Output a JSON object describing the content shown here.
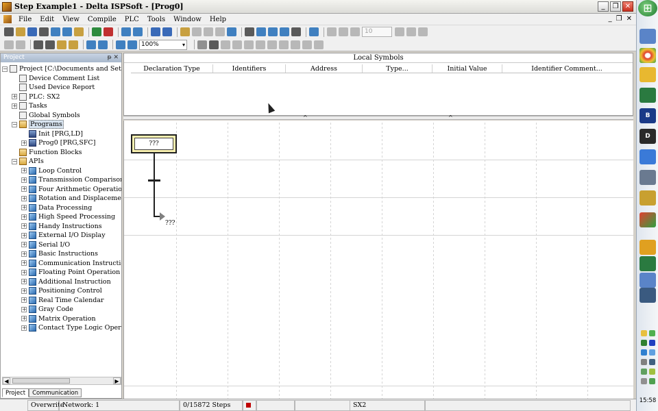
{
  "window": {
    "title": "Step Example1 - Delta ISPSoft - [Prog0]",
    "buttons": [
      "_",
      "❐",
      "✕"
    ]
  },
  "menu": {
    "items": [
      "File",
      "Edit",
      "View",
      "Compile",
      "PLC",
      "Tools",
      "Window",
      "Help"
    ],
    "mdi_buttons": [
      "_",
      "❐",
      "✕"
    ]
  },
  "toolbar": {
    "zoom": "100%",
    "spin_value": "10"
  },
  "project_panel": {
    "title": "Project",
    "controls": "ᵽ ✕",
    "tree": [
      {
        "label": "Project [C:\\Documents and Settings\\c",
        "level": 0,
        "expander": "−",
        "icon": "doc"
      },
      {
        "label": "Device Comment List",
        "level": 1,
        "expander": "",
        "icon": "doc"
      },
      {
        "label": "Used Device Report",
        "level": 1,
        "expander": "",
        "icon": "doc"
      },
      {
        "label": "PLC: SX2",
        "level": 1,
        "expander": "+",
        "icon": "doc"
      },
      {
        "label": "Tasks",
        "level": 1,
        "expander": "+",
        "icon": "doc"
      },
      {
        "label": "Global Symbols",
        "level": 1,
        "expander": "",
        "icon": "doc"
      },
      {
        "label": "Programs",
        "level": 1,
        "expander": "−",
        "icon": "folder",
        "selected": true
      },
      {
        "label": "Init [PRG,LD]",
        "level": 2,
        "expander": "",
        "icon": "prg"
      },
      {
        "label": "Prog0 [PRG,SFC]",
        "level": 2,
        "expander": "+",
        "icon": "prg"
      },
      {
        "label": "Function Blocks",
        "level": 1,
        "expander": "",
        "icon": "folder"
      },
      {
        "label": "APIs",
        "level": 1,
        "expander": "−",
        "icon": "folder"
      },
      {
        "label": "Loop Control",
        "level": 2,
        "expander": "+",
        "icon": "cube"
      },
      {
        "label": "Transmission Comparison",
        "level": 2,
        "expander": "+",
        "icon": "cube"
      },
      {
        "label": "Four Arithmetic Operations",
        "level": 2,
        "expander": "+",
        "icon": "cube"
      },
      {
        "label": "Rotation and Displacement",
        "level": 2,
        "expander": "+",
        "icon": "cube"
      },
      {
        "label": "Data Processing",
        "level": 2,
        "expander": "+",
        "icon": "cube"
      },
      {
        "label": "High Speed Processing",
        "level": 2,
        "expander": "+",
        "icon": "cube"
      },
      {
        "label": "Handy Instructions",
        "level": 2,
        "expander": "+",
        "icon": "cube"
      },
      {
        "label": "External I/O Display",
        "level": 2,
        "expander": "+",
        "icon": "cube"
      },
      {
        "label": "Serial I/O",
        "level": 2,
        "expander": "+",
        "icon": "cube"
      },
      {
        "label": "Basic Instructions",
        "level": 2,
        "expander": "+",
        "icon": "cube"
      },
      {
        "label": "Communication Instructions",
        "level": 2,
        "expander": "+",
        "icon": "cube"
      },
      {
        "label": "Floating Point Operation",
        "level": 2,
        "expander": "+",
        "icon": "cube"
      },
      {
        "label": "Additional Instruction",
        "level": 2,
        "expander": "+",
        "icon": "cube"
      },
      {
        "label": "Positioning Control",
        "level": 2,
        "expander": "+",
        "icon": "cube"
      },
      {
        "label": "Real Time Calendar",
        "level": 2,
        "expander": "+",
        "icon": "cube"
      },
      {
        "label": "Gray Code",
        "level": 2,
        "expander": "+",
        "icon": "cube"
      },
      {
        "label": "Matrix Operation",
        "level": 2,
        "expander": "+",
        "icon": "cube"
      },
      {
        "label": "Contact Type Logic Operation",
        "level": 2,
        "expander": "+",
        "icon": "cube"
      }
    ],
    "tabs": [
      "Project",
      "Communication"
    ]
  },
  "local_symbols": {
    "title": "Local Symbols",
    "columns": [
      "Declaration Type",
      "Identifiers",
      "Address",
      "Type...",
      "Initial Value",
      "Identifier Comment..."
    ]
  },
  "sfc": {
    "step_label": "???",
    "jump_label": "???"
  },
  "status": {
    "mode": "Overwrite",
    "network": "Network: 1",
    "steps": "0/15872 Steps",
    "plc": "SX2"
  },
  "taskbar": {
    "start_glyph": "⊞",
    "clock": "15:58"
  }
}
